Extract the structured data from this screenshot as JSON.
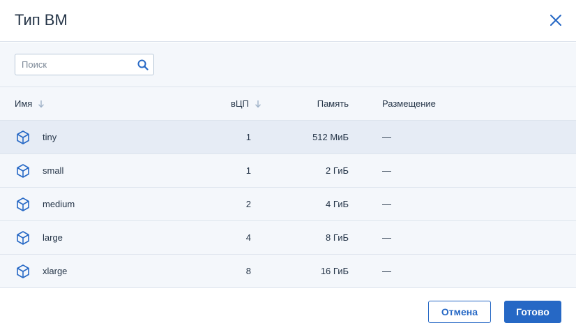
{
  "dialog": {
    "title": "Тип ВМ",
    "close_icon": "close-icon"
  },
  "search": {
    "placeholder": "Поиск",
    "value": "",
    "icon": "search-icon"
  },
  "table": {
    "columns": {
      "name": "Имя",
      "vcpu": "вЦП",
      "memory": "Память",
      "placement": "Размещение"
    },
    "sortable_columns": [
      "name",
      "vcpu"
    ],
    "rows": [
      {
        "name": "tiny",
        "vcpu": "1",
        "memory": "512 МиБ",
        "placement": "—",
        "selected": true
      },
      {
        "name": "small",
        "vcpu": "1",
        "memory": "2 ГиБ",
        "placement": "—",
        "selected": false
      },
      {
        "name": "medium",
        "vcpu": "2",
        "memory": "4 ГиБ",
        "placement": "—",
        "selected": false
      },
      {
        "name": "large",
        "vcpu": "4",
        "memory": "8 ГиБ",
        "placement": "—",
        "selected": false
      },
      {
        "name": "xlarge",
        "vcpu": "8",
        "memory": "16 ГиБ",
        "placement": "—",
        "selected": false
      }
    ],
    "row_icon": "vm-cube-icon"
  },
  "footer": {
    "cancel_label": "Отмена",
    "done_label": "Готово"
  },
  "colors": {
    "accent": "#2668c5",
    "text": "#243447",
    "body_bg": "#f4f7fb",
    "selected_row_bg": "#e6ecf5",
    "border": "#dde4ed",
    "sort_arrow": "#9fb2c8"
  }
}
